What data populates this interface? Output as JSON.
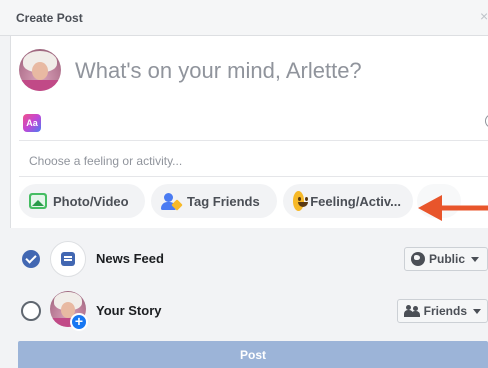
{
  "header": {
    "title": "Create Post",
    "close_glyph": "×"
  },
  "composer": {
    "prompt": "What's on your mind, Arlette?",
    "text_format_icon_label": "Aa",
    "feeling_placeholder": "Choose a feeling or activity..."
  },
  "actions": [
    {
      "label": "Photo/Video",
      "icon": "photo-icon"
    },
    {
      "label": "Tag Friends",
      "icon": "tag-friends-icon"
    },
    {
      "label": "Feeling/Activ...",
      "icon": "feeling-icon"
    }
  ],
  "share": {
    "news_feed": {
      "label": "News Feed",
      "audience": "Public",
      "checked": true
    },
    "story": {
      "label": "Your Story",
      "audience": "Friends",
      "checked": false,
      "badge": "+"
    }
  },
  "post_button": {
    "label": "Post"
  },
  "colors": {
    "accent": "#4267b2",
    "post_disabled": "#9cb4d8",
    "annotation_arrow": "#e8552b"
  }
}
